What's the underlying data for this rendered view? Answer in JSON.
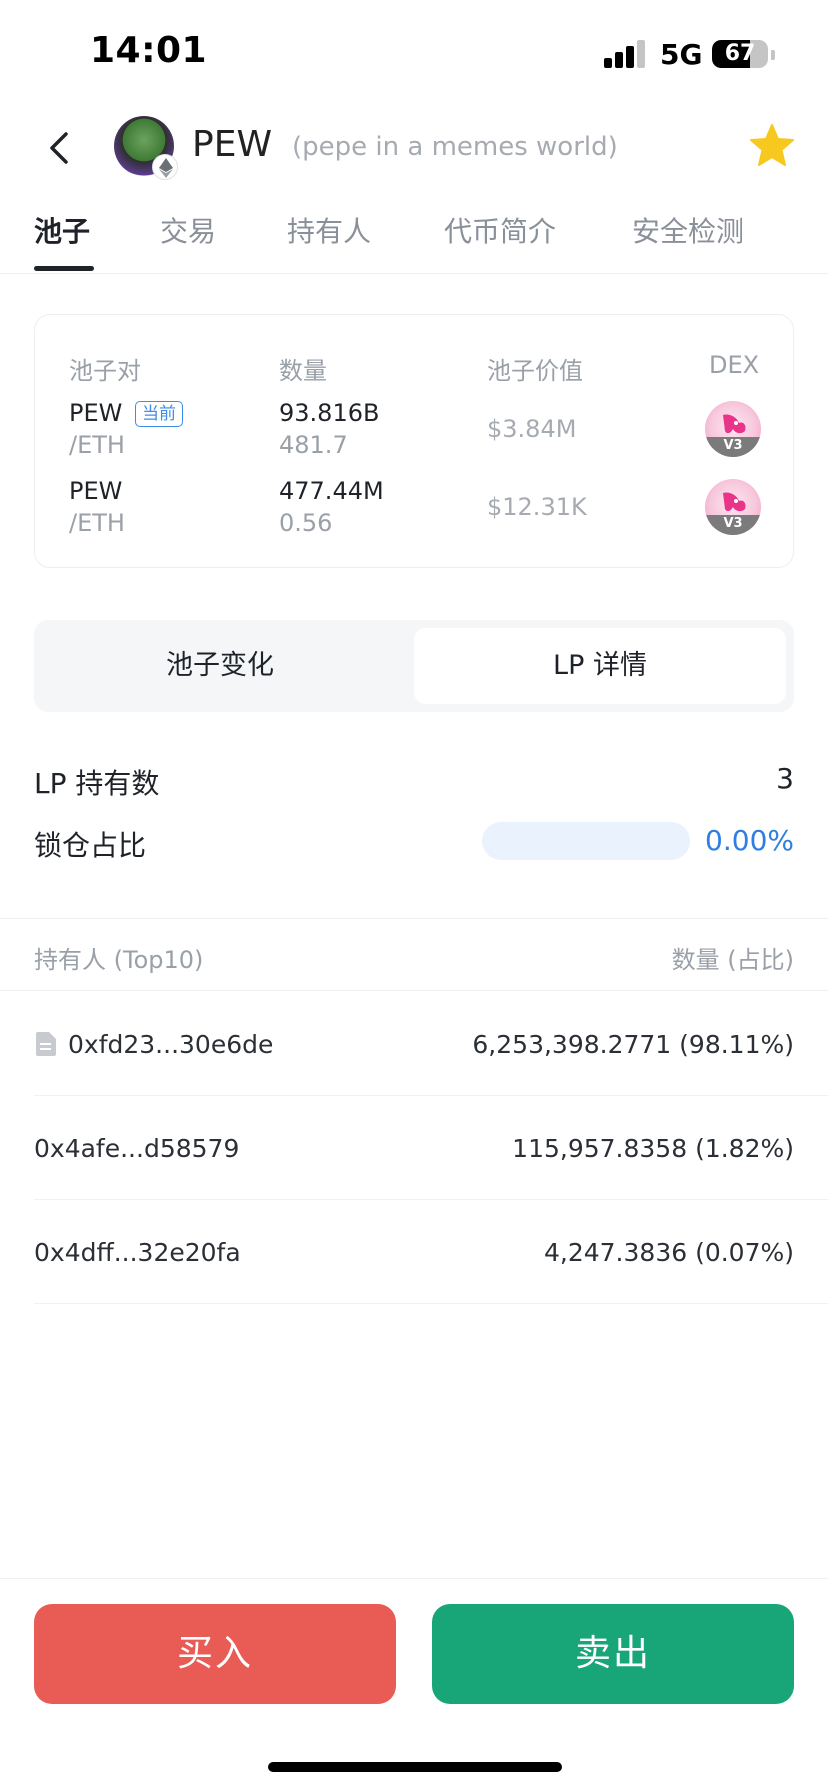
{
  "status_bar": {
    "time": "14:01",
    "network": "5G",
    "battery": "67",
    "battery_level": 0.67
  },
  "header": {
    "symbol": "PEW",
    "name": "(pepe in a memes world)"
  },
  "tabs": [
    {
      "label": "池子",
      "active": true
    },
    {
      "label": "交易"
    },
    {
      "label": "持有人"
    },
    {
      "label": "代币简介"
    },
    {
      "label": "安全检测"
    }
  ],
  "pool_table": {
    "headers": [
      "池子对",
      "数量",
      "池子价值",
      "DEX"
    ],
    "rows": [
      {
        "base": "PEW",
        "quote": "/ETH",
        "badge": "当前",
        "qty_base": "93.816B",
        "qty_quote": "481.7",
        "value": "$3.84M",
        "dex_icon": "uniswap-v3-icon",
        "dex_version": "V3"
      },
      {
        "base": "PEW",
        "quote": "/ETH",
        "qty_base": "477.44M",
        "qty_quote": "0.56",
        "value": "$12.31K",
        "dex_icon": "uniswap-v3-icon",
        "dex_version": "V3"
      }
    ]
  },
  "segment": {
    "left": "池子变化",
    "right": "LP 详情",
    "selected": "right"
  },
  "lp": {
    "holders_label": "LP 持有数",
    "holders_value": "3",
    "lock_label": "锁仓占比",
    "lock_value": "0.00%",
    "lock_fraction": 0
  },
  "holders": {
    "header_left": "持有人 (Top10)",
    "header_right": "数量 (占比)",
    "rows": [
      {
        "address": "0xfd23...30e6de",
        "amount": "6,253,398.2771 (98.11%)",
        "icon": "document-icon"
      },
      {
        "address": "0x4afe...d58579",
        "amount": "115,957.8358 (1.82%)"
      },
      {
        "address": "0x4dff...32e20fa",
        "amount": "4,247.3836 (0.07%)"
      }
    ]
  },
  "actions": {
    "buy": "买入",
    "sell": "卖出"
  },
  "colors": {
    "buy": "#e95c55",
    "sell": "#18a679",
    "accent": "#2f7fe0",
    "star": "#f7c81e"
  }
}
